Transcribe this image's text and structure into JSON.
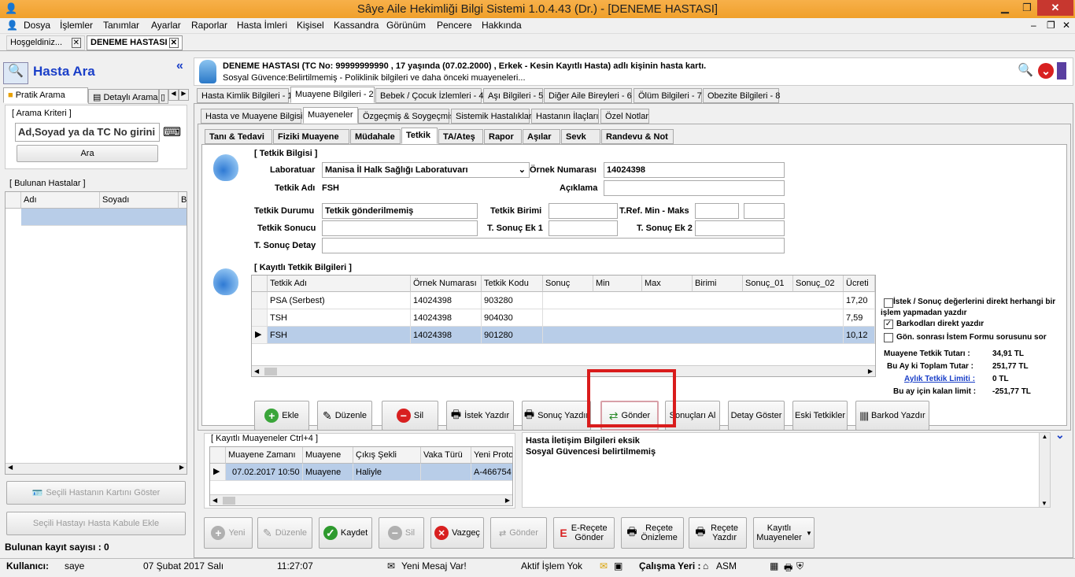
{
  "window": {
    "title": "Sâye Aile Hekimliği Bilgi Sistemi 1.0.4.43 (Dr.) - [DENEME HASTASI]"
  },
  "menu": [
    "Dosya",
    "İşlemler",
    "Tanımlar",
    "Ayarlar",
    "Raporlar",
    "Hasta İmleri",
    "Kişisel",
    "Kassandra",
    "Görünüm",
    "Pencere",
    "Hakkında"
  ],
  "doc_tabs": [
    "Hoşgeldiniz...",
    "DENEME HASTASI"
  ],
  "left": {
    "title": "Hasta Ara",
    "tabs": [
      "Pratik Arama",
      "Detaylı Arama"
    ],
    "criteria_label": "[ Arama Kriteri ]",
    "search_value": "Ad,Soyad ya da TC No girini",
    "search_button": "Ara",
    "found_label": "[ Bulunan Hastalar ]",
    "columns": [
      "Adı",
      "Soyadı",
      "B"
    ],
    "show_card_button": "Seçili Hastanın Kartını Göster",
    "add_admission_button": "Seçili Hastayı Hasta Kabule Ekle",
    "count_label": "Bulunan kayıt sayısı : 0"
  },
  "patient": {
    "header": "DENEME HASTASI (TC No: 99999999990 , 17 yaşında (07.02.2000) , Erkek - Kesin Kayıtlı Hasta) adlı kişinin hasta kartı.",
    "subheader": "Sosyal Güvence:Belirtilmemiş - Poliklinik bilgileri ve daha önceki muayeneleri..."
  },
  "main_tabs": [
    "Hasta Kimlik Bilgileri - 1",
    "Muayene Bilgileri - 2",
    "Bebek / Çocuk İzlemleri - 4",
    "Aşı Bilgileri - 5",
    "Diğer Aile Bireyleri - 6",
    "Ölüm Bilgileri - 7",
    "Obezite Bilgileri - 8"
  ],
  "sub_tabs": [
    "Hasta ve Muayene Bilgisi",
    "Muayeneler",
    "Özgeçmiş & Soygeçmiş",
    "Sistemik Hastalıklar",
    "Hastanın İlaçları",
    "Özel Notlar"
  ],
  "inner_tabs": [
    "Tanı & Tedavi",
    "Fiziki Muayene",
    "Müdahale",
    "Tetkik",
    "TA/Ateş",
    "Rapor",
    "Aşılar",
    "Sevk",
    "Randevu & Not"
  ],
  "tetkik": {
    "group_label": "[ Tetkik Bilgisi ]",
    "laboratuvar_label": "Laboratuar",
    "laboratuvar_value": "Manisa İl Halk Sağlığı Laboratuvarı",
    "ornek_label": "Örnek Numarası",
    "ornek_value": "14024398",
    "tetkik_adi_label": "Tetkik Adı",
    "tetkik_adi_value": "FSH",
    "aciklama_label": "Açıklama",
    "durum_label": "Tetkik Durumu",
    "durum_value": "Tetkik gönderilmemiş",
    "birim_label": "Tetkik Birimi",
    "ref_label": "T.Ref. Min - Maks",
    "sonuc_label": "Tetkik Sonucu",
    "ek1_label": "T. Sonuç Ek 1",
    "ek2_label": "T. Sonuç Ek 2",
    "detay_label": "T. Sonuç Detay"
  },
  "kayitli": {
    "group_label": "[ Kayıtlı Tetkik Bilgileri ]",
    "columns": [
      "Tetkik Adı",
      "Örnek Numarası",
      "Tetkik Kodu",
      "Sonuç",
      "Min",
      "Max",
      "Birimi",
      "Sonuç_01",
      "Sonuç_02",
      "Ücreti"
    ],
    "rows": [
      {
        "ad": "PSA (Serbest)",
        "ornek": "14024398",
        "kod": "903280",
        "ucret": "17,20"
      },
      {
        "ad": "TSH",
        "ornek": "14024398",
        "kod": "904030",
        "ucret": "7,59"
      },
      {
        "ad": "FSH",
        "ornek": "14024398",
        "kod": "901280",
        "ucret": "10,12"
      }
    ]
  },
  "options": {
    "opt1": "İstek / Sonuç değerlerini direkt herhangi bir işlem yapmadan yazdır",
    "opt2": "Barkodları direkt yazdır",
    "opt3": "Gön. sonrası İstem Formu sorusunu sor",
    "tutar_label": "Muayene Tetkik Tutarı :",
    "tutar_value": "34,91 TL",
    "toplam_label": "Bu Ay ki Toplam Tutar :",
    "toplam_value": "251,77 TL",
    "limit_label": "Aylık Tetkik Limiti :",
    "limit_value": "0 TL",
    "kalan_label": "Bu ay için kalan limit :",
    "kalan_value": "-251,77 TL"
  },
  "tetkik_buttons": [
    "Ekle",
    "Düzenle",
    "Sil",
    "İstek Yazdır",
    "Sonuç Yazdır",
    "Gönder",
    "Sonuçları Al",
    "Detay Göster",
    "Eski Tetkikler",
    "Barkod Yazdır"
  ],
  "muayeneler": {
    "label": "[ Kayıtlı Muayeneler Ctrl+4 ]",
    "columns": [
      "Muayene Zamanı",
      "Muayene",
      "Çıkış Şekli",
      "Vaka Türü",
      "Yeni Proto"
    ],
    "row": {
      "zaman": "07.02.2017 10:50",
      "muayene": "Muayene",
      "cikis": "Haliyle",
      "vaka": "",
      "proto": "A-466754"
    }
  },
  "info_text": [
    "Hasta İletişim Bilgileri eksik",
    "Sosyal Güvencesi belirtilmemiş"
  ],
  "bottom_buttons": [
    "Yeni",
    "Düzenle",
    "Kaydet",
    "Sil",
    "Vazgeç",
    "Gönder",
    "E-Reçete Gönder",
    "Reçete Önizleme",
    "Reçete Yazdır",
    "Kayıtlı Muayeneler"
  ],
  "status": {
    "user_label": "Kullanıcı:",
    "user": "saye",
    "date": "07 Şubat 2017 Salı",
    "time": "11:27:07",
    "message": "Yeni Mesaj Var!",
    "process": "Aktif İşlem Yok",
    "workplace_label": "Çalışma Yeri :",
    "workplace": "ASM"
  },
  "colors": {
    "titlebar": "#f0a02a",
    "highlight": "#d91c1c",
    "selected_row": "#b8cde8",
    "link": "#1a3fc8"
  }
}
